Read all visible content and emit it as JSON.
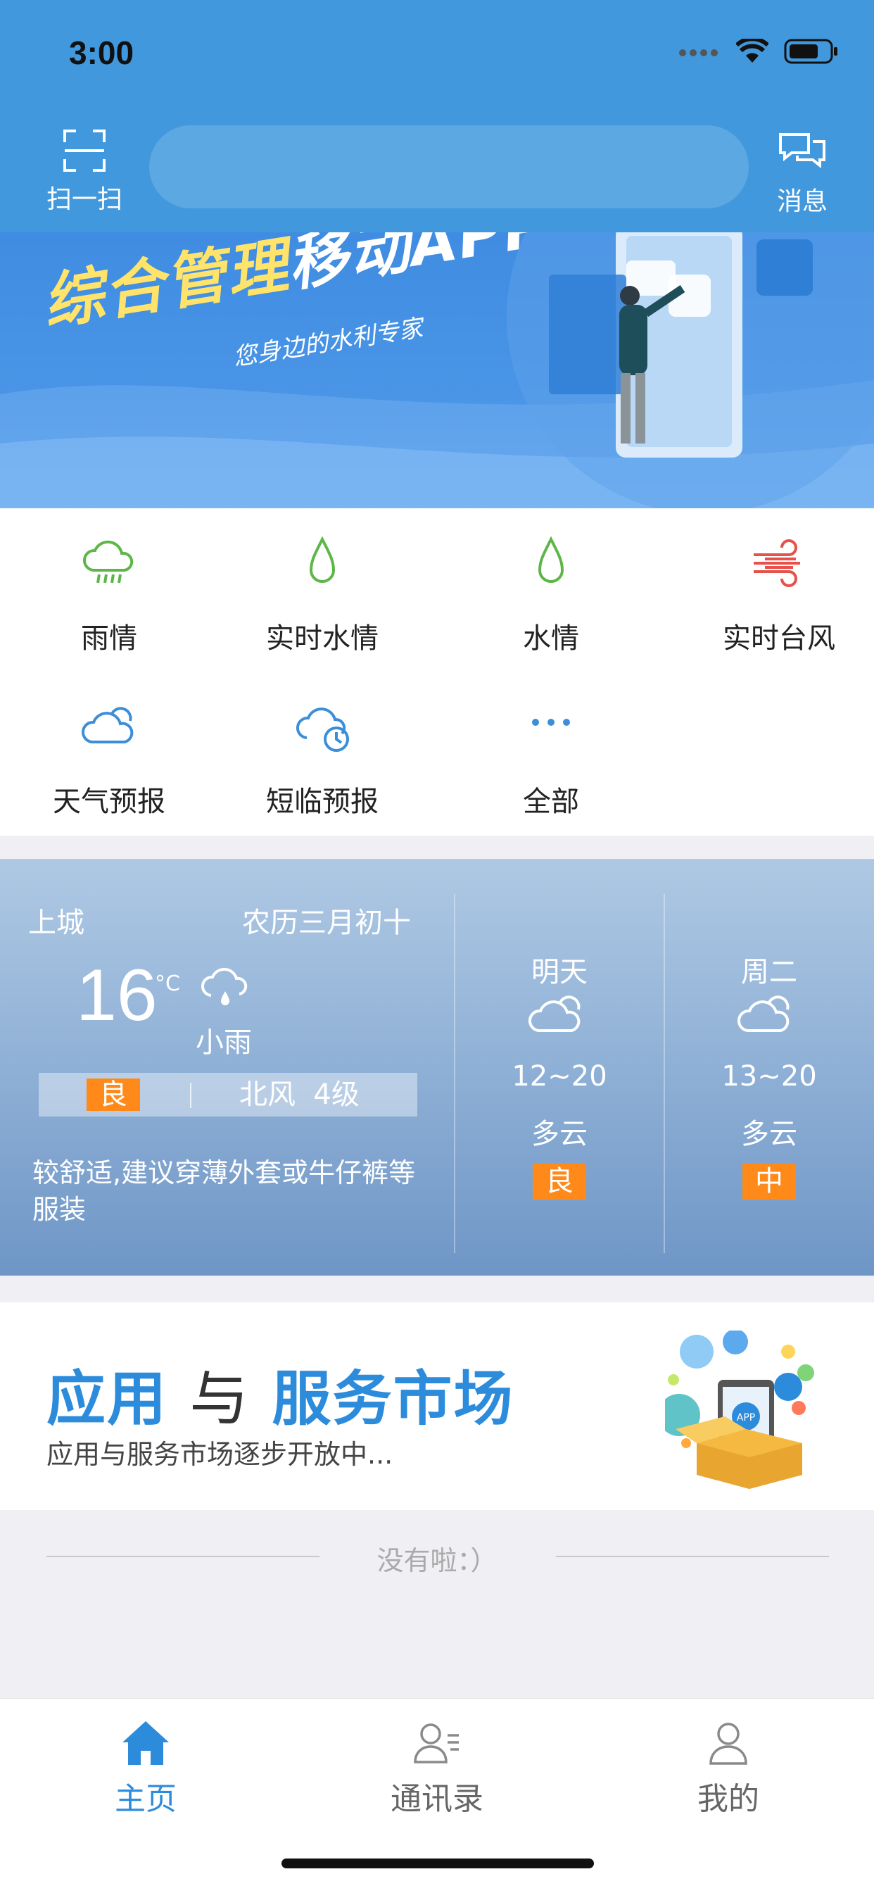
{
  "status_bar": {
    "time": "3:00"
  },
  "header": {
    "scan_label": "扫一扫",
    "message_label": "消息",
    "search_placeholder": ""
  },
  "banner": {
    "title_yellow": "综合管理",
    "title_white": "移动APP",
    "subtitle": "您身边的水利专家"
  },
  "functions": [
    {
      "label": "雨情",
      "icon": "rain-cloud-icon"
    },
    {
      "label": "实时水情",
      "icon": "water-drop-icon"
    },
    {
      "label": "水情",
      "icon": "water-drop-icon"
    },
    {
      "label": "实时台风",
      "icon": "wind-icon"
    },
    {
      "label": "天气预报",
      "icon": "cloud-icon"
    },
    {
      "label": "短临预报",
      "icon": "cloud-clock-icon"
    },
    {
      "label": "全部",
      "icon": "more-dots-icon"
    }
  ],
  "weather": {
    "city": "上城",
    "lunar_date": "农历三月初十",
    "temp": "16",
    "unit": "°C",
    "condition": "小雨",
    "aqi": "良",
    "wind": "北风  4级",
    "advice": "较舒适,建议穿薄外套或牛仔裤等服装",
    "forecast": [
      {
        "day": "明天",
        "range": "12~20",
        "condition": "多云",
        "aqi": "良"
      },
      {
        "day": "周二",
        "range": "13~20",
        "condition": "多云",
        "aqi": "中"
      }
    ]
  },
  "market": {
    "title_part1": "应用",
    "title_part2": "与",
    "title_part3": "服务市场",
    "subtitle": "应用与服务市场逐步开放中...",
    "badge_text": "APP"
  },
  "footer_note": "没有啦：）",
  "tabs": [
    {
      "label": "主页",
      "active": true
    },
    {
      "label": "通讯录",
      "active": false
    },
    {
      "label": "我的",
      "active": false
    }
  ],
  "colors": {
    "primary": "#2C8CDB",
    "header": "#4298DC",
    "badge": "#FF8A1A",
    "green_icon": "#5DB648",
    "blue_icon": "#3C8ED8",
    "red_icon": "#E8504A"
  }
}
